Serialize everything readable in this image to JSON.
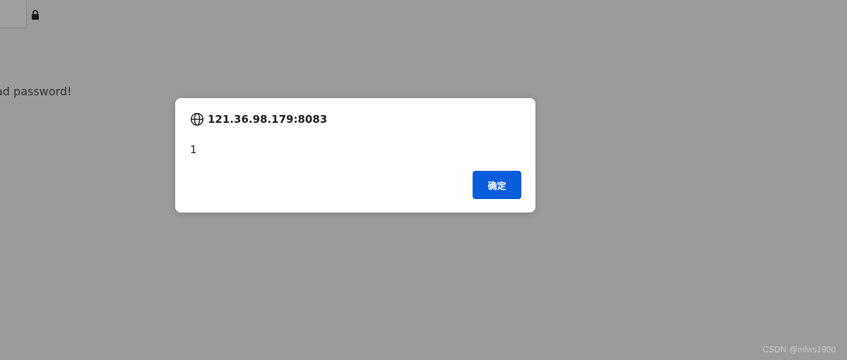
{
  "background": {
    "message": "ad password!",
    "overlay_color": "#9b9b9c"
  },
  "dialog": {
    "origin": "121.36.98.179:8083",
    "message": "1",
    "ok_label": "确定",
    "button_color": "#0a5ddb",
    "icons": {
      "origin": "globe-icon"
    }
  },
  "watermark": "CSDN @mlws1900"
}
